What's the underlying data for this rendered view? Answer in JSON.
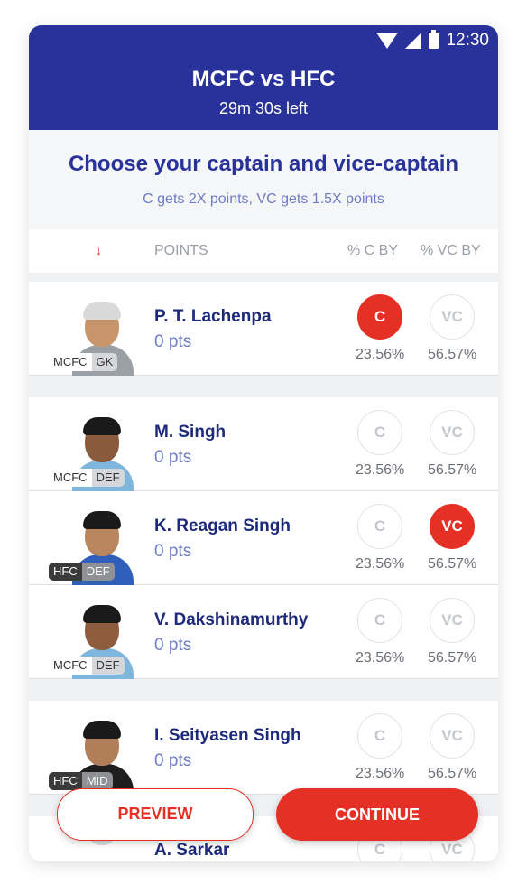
{
  "status_bar": {
    "time": "12:30"
  },
  "header": {
    "match": "MCFC vs HFC",
    "time_left": "29m 30s left"
  },
  "intro": {
    "title": "Choose your captain and vice-captain",
    "subtitle": "C gets 2X points, VC gets 1.5X points"
  },
  "columns": {
    "sort_icon": "↓",
    "points": "POINTS",
    "c_by": "% C BY",
    "vc_by": "% VC BY"
  },
  "players": [
    {
      "name": "P. T. Lachenpa",
      "pts": "0 pts",
      "team": "MCFC",
      "pos": "GK",
      "c_label": "C",
      "vc_label": "VC",
      "c_pct": "23.56%",
      "vc_pct": "56.57%",
      "selected": "C"
    },
    {
      "name": "M. Singh",
      "pts": "0 pts",
      "team": "MCFC",
      "pos": "DEF",
      "c_label": "C",
      "vc_label": "VC",
      "c_pct": "23.56%",
      "vc_pct": "56.57%",
      "selected": ""
    },
    {
      "name": "K. Reagan Singh",
      "pts": "0 pts",
      "team": "HFC",
      "pos": "DEF",
      "c_label": "C",
      "vc_label": "VC",
      "c_pct": "23.56%",
      "vc_pct": "56.57%",
      "selected": "VC"
    },
    {
      "name": "V. Dakshinamurthy",
      "pts": "0 pts",
      "team": "MCFC",
      "pos": "DEF",
      "c_label": "C",
      "vc_label": "VC",
      "c_pct": "23.56%",
      "vc_pct": "56.57%",
      "selected": ""
    },
    {
      "name": "I. Seityasen Singh",
      "pts": "0 pts",
      "team": "HFC",
      "pos": "MID",
      "c_label": "C",
      "vc_label": "VC",
      "c_pct": "23.56%",
      "vc_pct": "56.57%",
      "selected": ""
    },
    {
      "name": "A. Sarkar",
      "pts": "",
      "team": "",
      "pos": "",
      "c_label": "C",
      "vc_label": "VC",
      "c_pct": "",
      "vc_pct": "",
      "selected": ""
    }
  ],
  "buttons": {
    "preview": "PREVIEW",
    "continue": "CONTINUE"
  },
  "colors": {
    "header": "#28329a",
    "accent": "#e53025",
    "title": "#28329a",
    "subtle": "#6e7cc4"
  }
}
